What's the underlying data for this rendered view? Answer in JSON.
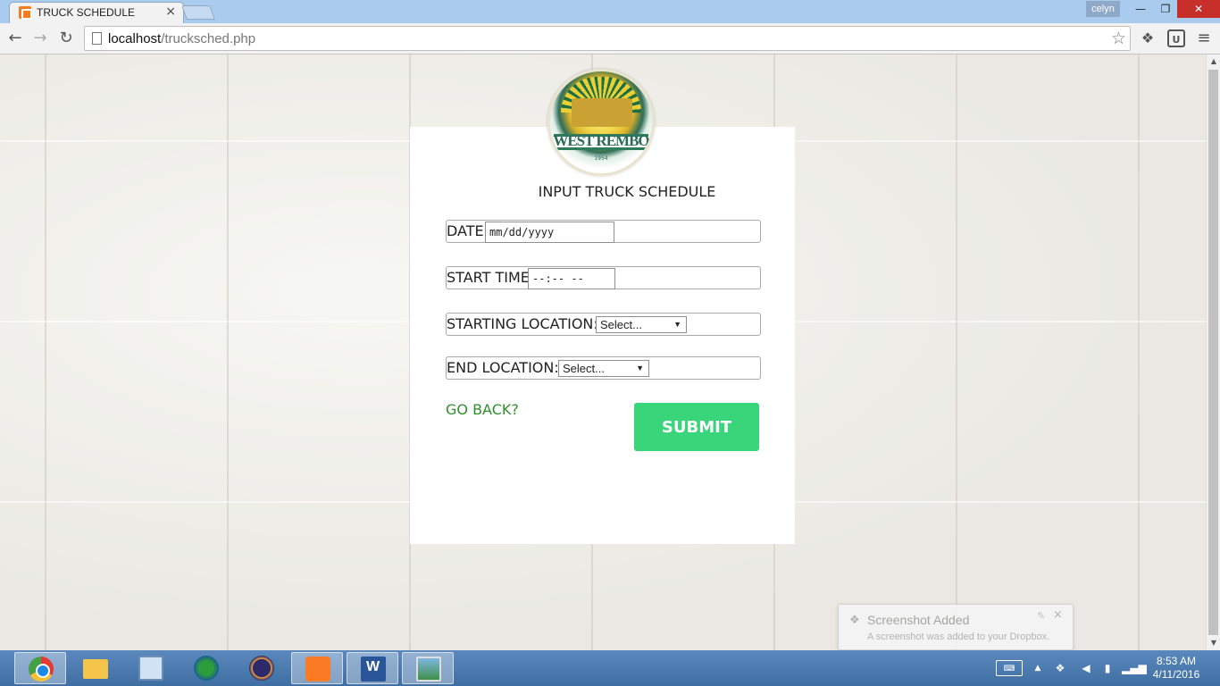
{
  "browser": {
    "tab_title": "TRUCK SCHEDULE",
    "tab_close": "×",
    "profile_name": "celyn",
    "window_min": "—",
    "window_max": "❐",
    "window_close": "✕",
    "nav_back": "←",
    "nav_forward": "→",
    "nav_reload": "↻",
    "url_host": "localhost",
    "url_path": "/trucksched.php",
    "star": "☆",
    "menu": "≡"
  },
  "page": {
    "logo_text": "WEST REMBO",
    "logo_year": "1954",
    "title": "INPUT TRUCK SCHEDULE",
    "fields": {
      "date_label": "DATE:",
      "date_value": "mm/dd/yyyy",
      "time_label": "START TIME:",
      "time_value": "--:-- --",
      "start_location_label": "STARTING LOCATION:",
      "start_location_value": "Select...",
      "end_location_label": "END LOCATION:",
      "end_location_value": "Select..."
    },
    "go_back": "GO BACK?",
    "submit": "SUBMIT",
    "accent_color": "#38d57a",
    "link_color": "#2f8f2f"
  },
  "toast": {
    "title": "Screenshot Added",
    "body": "A screenshot was added to your Dropbox.",
    "close": "×"
  },
  "taskbar": {
    "apps": [
      "chrome-icon",
      "file-explorer-icon",
      "server-manager-icon",
      "idm-icon",
      "eclipse-icon",
      "xampp-icon",
      "word-icon",
      "photos-icon"
    ],
    "clock_time": "8:53 AM",
    "clock_date": "4/11/2016"
  }
}
